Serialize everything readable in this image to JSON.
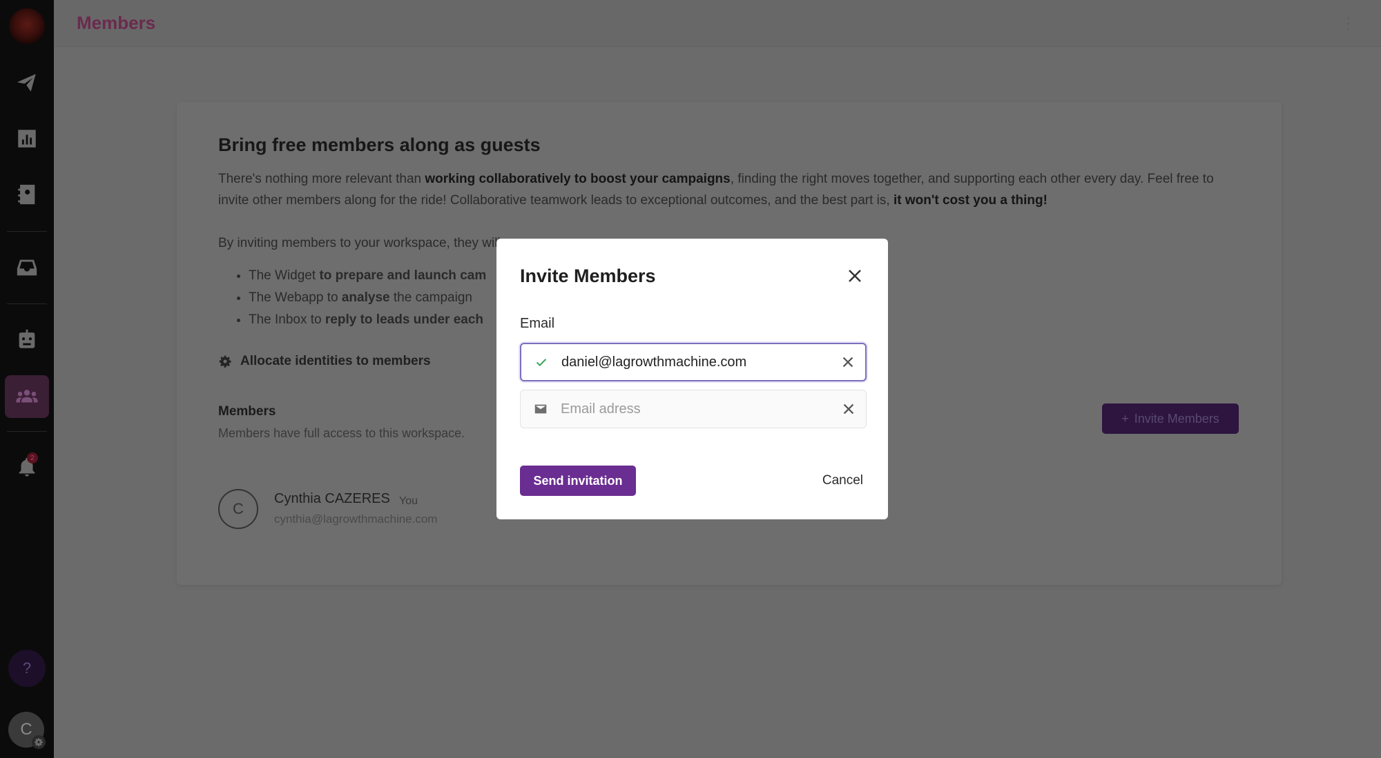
{
  "app": {
    "notification_count": "2",
    "help_label": "?",
    "user_initial": "C"
  },
  "header": {
    "title": "Members",
    "menu_icon": "kebab-icon"
  },
  "sidebar": {
    "items": [
      {
        "name": "campaigns",
        "icon": "paper-plane-icon"
      },
      {
        "name": "stats",
        "icon": "bar-chart-icon"
      },
      {
        "name": "contacts",
        "icon": "contact-book-icon"
      },
      {
        "name": "inbox",
        "icon": "inbox-tray-icon"
      },
      {
        "name": "bot",
        "icon": "robot-icon"
      },
      {
        "name": "members",
        "icon": "users-icon",
        "active": true
      },
      {
        "name": "notifications",
        "icon": "bell-icon"
      }
    ]
  },
  "main": {
    "title": "Bring free members along as guests",
    "intro_1": "There's nothing more relevant than ",
    "intro_1_bold": "working collaboratively to boost your campaigns",
    "intro_2": ", finding the right moves together, and supporting each other every day. Feel free to invite other members along for the ride! Collaborative teamwork leads to exceptional outcomes, and the best part is, ",
    "intro_2_bold": "it won't cost you a thing!",
    "inviting_text": "By inviting members to your workspace, they will",
    "bullets": [
      {
        "pre": "The Widget ",
        "bold": "to prepare and launch cam"
      },
      {
        "pre": "The Webapp to ",
        "bold": "analyse",
        "post": " the campaign"
      },
      {
        "pre": "The Inbox to ",
        "bold": "reply to leads under each"
      }
    ],
    "allocate_label": "Allocate identities to members",
    "members_heading": "Members",
    "members_sub": "Members have full access to this workspace.",
    "invite_button": "Invite Members",
    "member": {
      "initial": "C",
      "name": "Cynthia CAZERES",
      "badge": "You",
      "email": "cynthia@lagrowthmachine.com"
    }
  },
  "modal": {
    "title": "Invite Members",
    "email_label": "Email",
    "rows": [
      {
        "value": "daniel@lagrowthmachine.com",
        "status": "valid",
        "icon": "check-icon"
      },
      {
        "value": "",
        "placeholder": "Email adress",
        "icon": "mail-icon"
      }
    ],
    "send_label": "Send invitation",
    "cancel_label": "Cancel"
  },
  "colors": {
    "accent": "#6a2d91",
    "title_accent": "#6b2a4e",
    "valid_check": "#3aa55d",
    "overlay": "#6b6b6b"
  }
}
